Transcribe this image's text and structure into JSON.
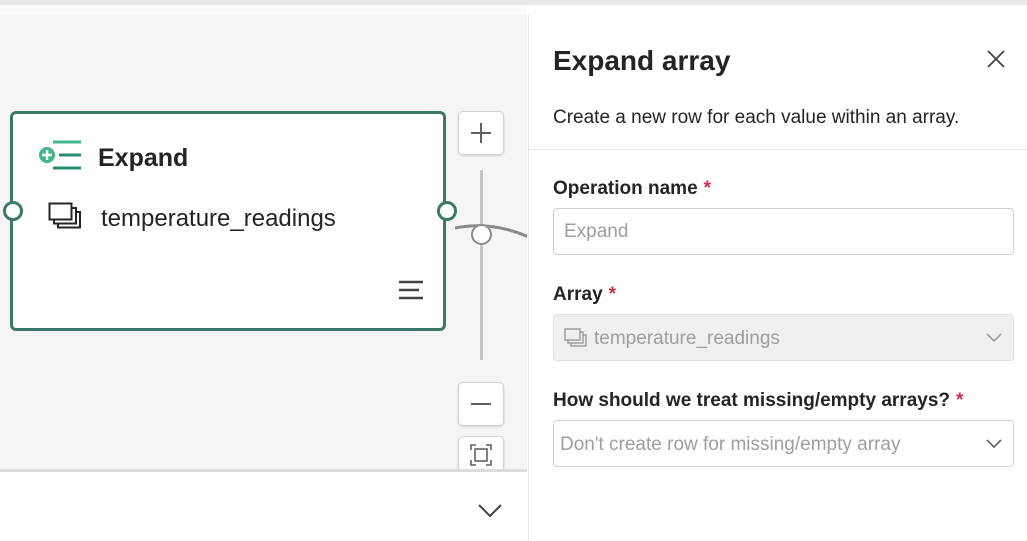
{
  "node": {
    "title": "Expand",
    "array_label": "temperature_readings",
    "icon": "expand-list-icon",
    "accent_color": "#3b7a68"
  },
  "canvas": {
    "zoom_in_icon": "plus-icon",
    "zoom_out_icon": "minus-icon",
    "fit_icon": "fit-to-screen-icon",
    "collapse_icon": "chevron-down-icon"
  },
  "panel": {
    "title": "Expand array",
    "description": "Create a new row for each value within an array.",
    "close_icon": "close-icon",
    "fields": {
      "operation_name": {
        "label": "Operation name",
        "required_mark": "*",
        "placeholder": "Expand",
        "value": ""
      },
      "array": {
        "label": "Array",
        "required_mark": "*",
        "value": "temperature_readings",
        "disabled": true
      },
      "missing": {
        "label": "How should we treat missing/empty arrays?",
        "required_mark": "*",
        "placeholder": "Don't create row for missing/empty array"
      }
    }
  }
}
